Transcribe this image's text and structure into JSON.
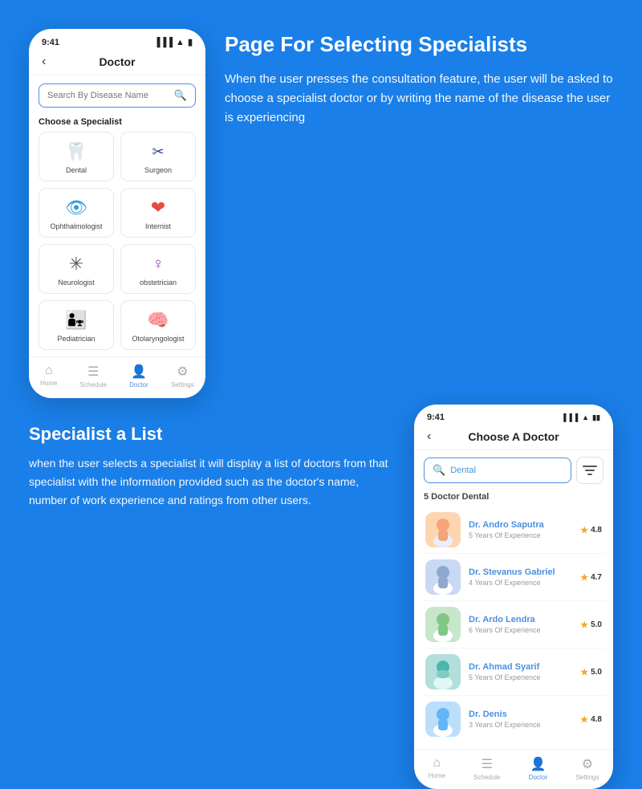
{
  "page": {
    "background": "#1a7fe8"
  },
  "top_right": {
    "title": "Page For Selecting Specialists",
    "description": "When the user presses the consultation feature, the user will be asked to choose a specialist doctor or by writing the name of the disease the user is experiencing"
  },
  "bottom_left": {
    "title": "Specialist a List",
    "description": "when the user selects a specialist it will display a list of doctors from that specialist with the information provided such as the doctor's name, number of work experience and ratings from other users."
  },
  "phone1": {
    "time": "9:41",
    "header_title": "Doctor",
    "search_placeholder": "Search By Disease Name",
    "section_label": "Choose a Specialist",
    "specialists": [
      {
        "name": "Dental",
        "icon": "🦷",
        "color": "dental-icon"
      },
      {
        "name": "Surgeon",
        "icon": "✂",
        "color": "surgeon-icon"
      },
      {
        "name": "Ophthalmologist",
        "icon": "👁",
        "color": "eye-icon"
      },
      {
        "name": "Internist",
        "icon": "❤",
        "color": "heart-icon"
      },
      {
        "name": "Neurologist",
        "icon": "✳",
        "color": "neuro-icon"
      },
      {
        "name": "obstetrician",
        "icon": "♀",
        "color": "ob-icon"
      },
      {
        "name": "Pediatrician",
        "icon": "👫",
        "color": "child-icon"
      },
      {
        "name": "Otolaryngologist",
        "icon": "🧠",
        "color": "ent-icon"
      }
    ],
    "nav": [
      {
        "label": "Home",
        "icon": "⌂",
        "active": false
      },
      {
        "label": "Schedule",
        "icon": "☰",
        "active": false
      },
      {
        "label": "Doctor",
        "icon": "👤",
        "active": true
      },
      {
        "label": "Settings",
        "icon": "⚙",
        "active": false
      }
    ]
  },
  "phone2": {
    "time": "9:41",
    "header_title": "Choose A Doctor",
    "search_value": "Dental",
    "doctor_count": "5 Doctor Dental",
    "doctors": [
      {
        "name": "Dr. Andro Saputra",
        "exp": "5 Years Of Experience",
        "rating": "4.8",
        "avatar": "👨‍⚕️",
        "av_class": "av1"
      },
      {
        "name": "Dr. Stevanus Gabriel",
        "exp": "4 Years Of Experience",
        "rating": "4.7",
        "avatar": "👨",
        "av_class": "av2"
      },
      {
        "name": "Dr. Ardo Lendra",
        "exp": "6 Years Of Experience",
        "rating": "5.0",
        "avatar": "👨‍⚕️",
        "av_class": "av3"
      },
      {
        "name": "Dr. Ahmad Syarif",
        "exp": "5 Years Of Experience",
        "rating": "5.0",
        "avatar": "😷",
        "av_class": "av4"
      },
      {
        "name": "Dr. Denis",
        "exp": "3 Years Of Experience",
        "rating": "4.8",
        "avatar": "👨",
        "av_class": "av5"
      }
    ],
    "nav": [
      {
        "label": "Home",
        "icon": "⌂",
        "active": false
      },
      {
        "label": "Schedule",
        "icon": "☰",
        "active": false
      },
      {
        "label": "Doctor",
        "icon": "👤",
        "active": true
      },
      {
        "label": "Settings",
        "icon": "⚙",
        "active": false
      }
    ]
  }
}
